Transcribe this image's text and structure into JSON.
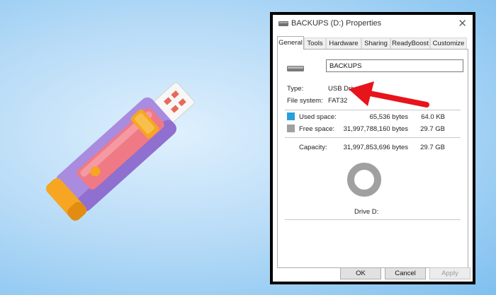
{
  "window": {
    "title": "BACKUPS (D:) Properties",
    "close_glyph": "✕"
  },
  "tabs": [
    {
      "label": "General",
      "active": true
    },
    {
      "label": "Tools",
      "active": false
    },
    {
      "label": "Hardware",
      "active": false
    },
    {
      "label": "Sharing",
      "active": false
    },
    {
      "label": "ReadyBoost",
      "active": false
    },
    {
      "label": "Customize",
      "active": false
    }
  ],
  "general": {
    "drive_name": "BACKUPS",
    "type_label": "Type:",
    "type_value": "USB Drive",
    "fs_label": "File system:",
    "fs_value": "FAT32",
    "used": {
      "label": "Used space:",
      "bytes": "65,536 bytes",
      "size": "64.0 KB",
      "color": "#26a0da"
    },
    "free": {
      "label": "Free space:",
      "bytes": "31,997,788,160 bytes",
      "size": "29.7 GB",
      "color": "#a0a0a0"
    },
    "capacity": {
      "label": "Capacity:",
      "bytes": "31,997,853,696 bytes",
      "size": "29.7 GB"
    },
    "drive_caption": "Drive D:",
    "used_fraction": 2e-06
  },
  "buttons": {
    "ok": "OK",
    "cancel": "Cancel",
    "apply": "Apply"
  },
  "colors": {
    "arrow": "#e8141b",
    "usb_body": "#a98be0",
    "usb_panel": "#ef7a85",
    "usb_cap": "#f6a623",
    "usb_connector": "#f4f4f4"
  }
}
